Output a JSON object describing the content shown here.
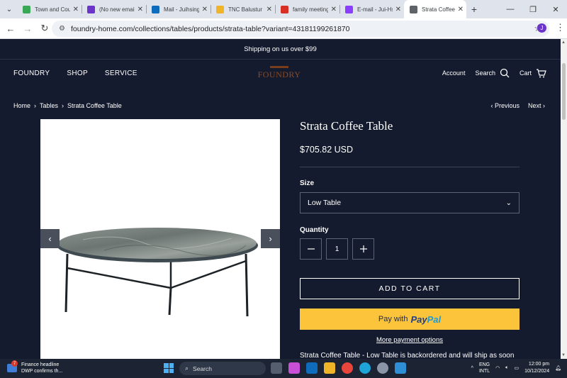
{
  "browser": {
    "tabs": [
      {
        "title": "Town and Cou",
        "color": "#3aa757",
        "active": false
      },
      {
        "title": "(No new email",
        "color": "#6b35c9",
        "active": false
      },
      {
        "title": "Mail - Juihsing",
        "color": "#0f6cbd",
        "active": false
      },
      {
        "title": "TNC Balustur L",
        "color": "#f0b429",
        "active": false
      },
      {
        "title": "family meeting",
        "color": "#d93025",
        "active": false
      },
      {
        "title": "E-mail - Jui-Hs",
        "color": "#8a3ffc",
        "active": false
      },
      {
        "title": "Strata Coffee T",
        "color": "#5f6368",
        "active": true
      }
    ],
    "url": "foundry-home.com/collections/tables/products/strata-table?variant=43181199261870",
    "profile_initial": "J"
  },
  "store": {
    "announcement": "Shipping on us over $99",
    "nav_left": [
      "FOUNDRY",
      "SHOP",
      "SERVICE"
    ],
    "logo_text": "FOUNDRY",
    "account": "Account",
    "search": "Search",
    "cart": "Cart"
  },
  "breadcrumb": {
    "home": "Home",
    "category": "Tables",
    "current": "Strata Coffee Table"
  },
  "pager": {
    "previous": "Previous",
    "next": "Next"
  },
  "product": {
    "title": "Strata Coffee Table",
    "price": "$705.82 USD",
    "size_label": "Size",
    "size_value": "Low Table",
    "quantity_label": "Quantity",
    "quantity": "1",
    "add_to_cart": "ADD TO CART",
    "paypal_prefix": "Pay with",
    "paypal_brand_1": "Pay",
    "paypal_brand_2": "Pal",
    "more_payment": "More payment options",
    "description": "Strata Coffee Table - Low Table is backordered and will ship as soon"
  },
  "taskbar": {
    "news_badge": "7",
    "news_title": "Finance headline",
    "news_sub": "DWP confirms th...",
    "search_placeholder": "Search",
    "lang_1": "ENG",
    "lang_2": "INTL",
    "time": "12:00 pm",
    "date": "10/12/2024"
  }
}
